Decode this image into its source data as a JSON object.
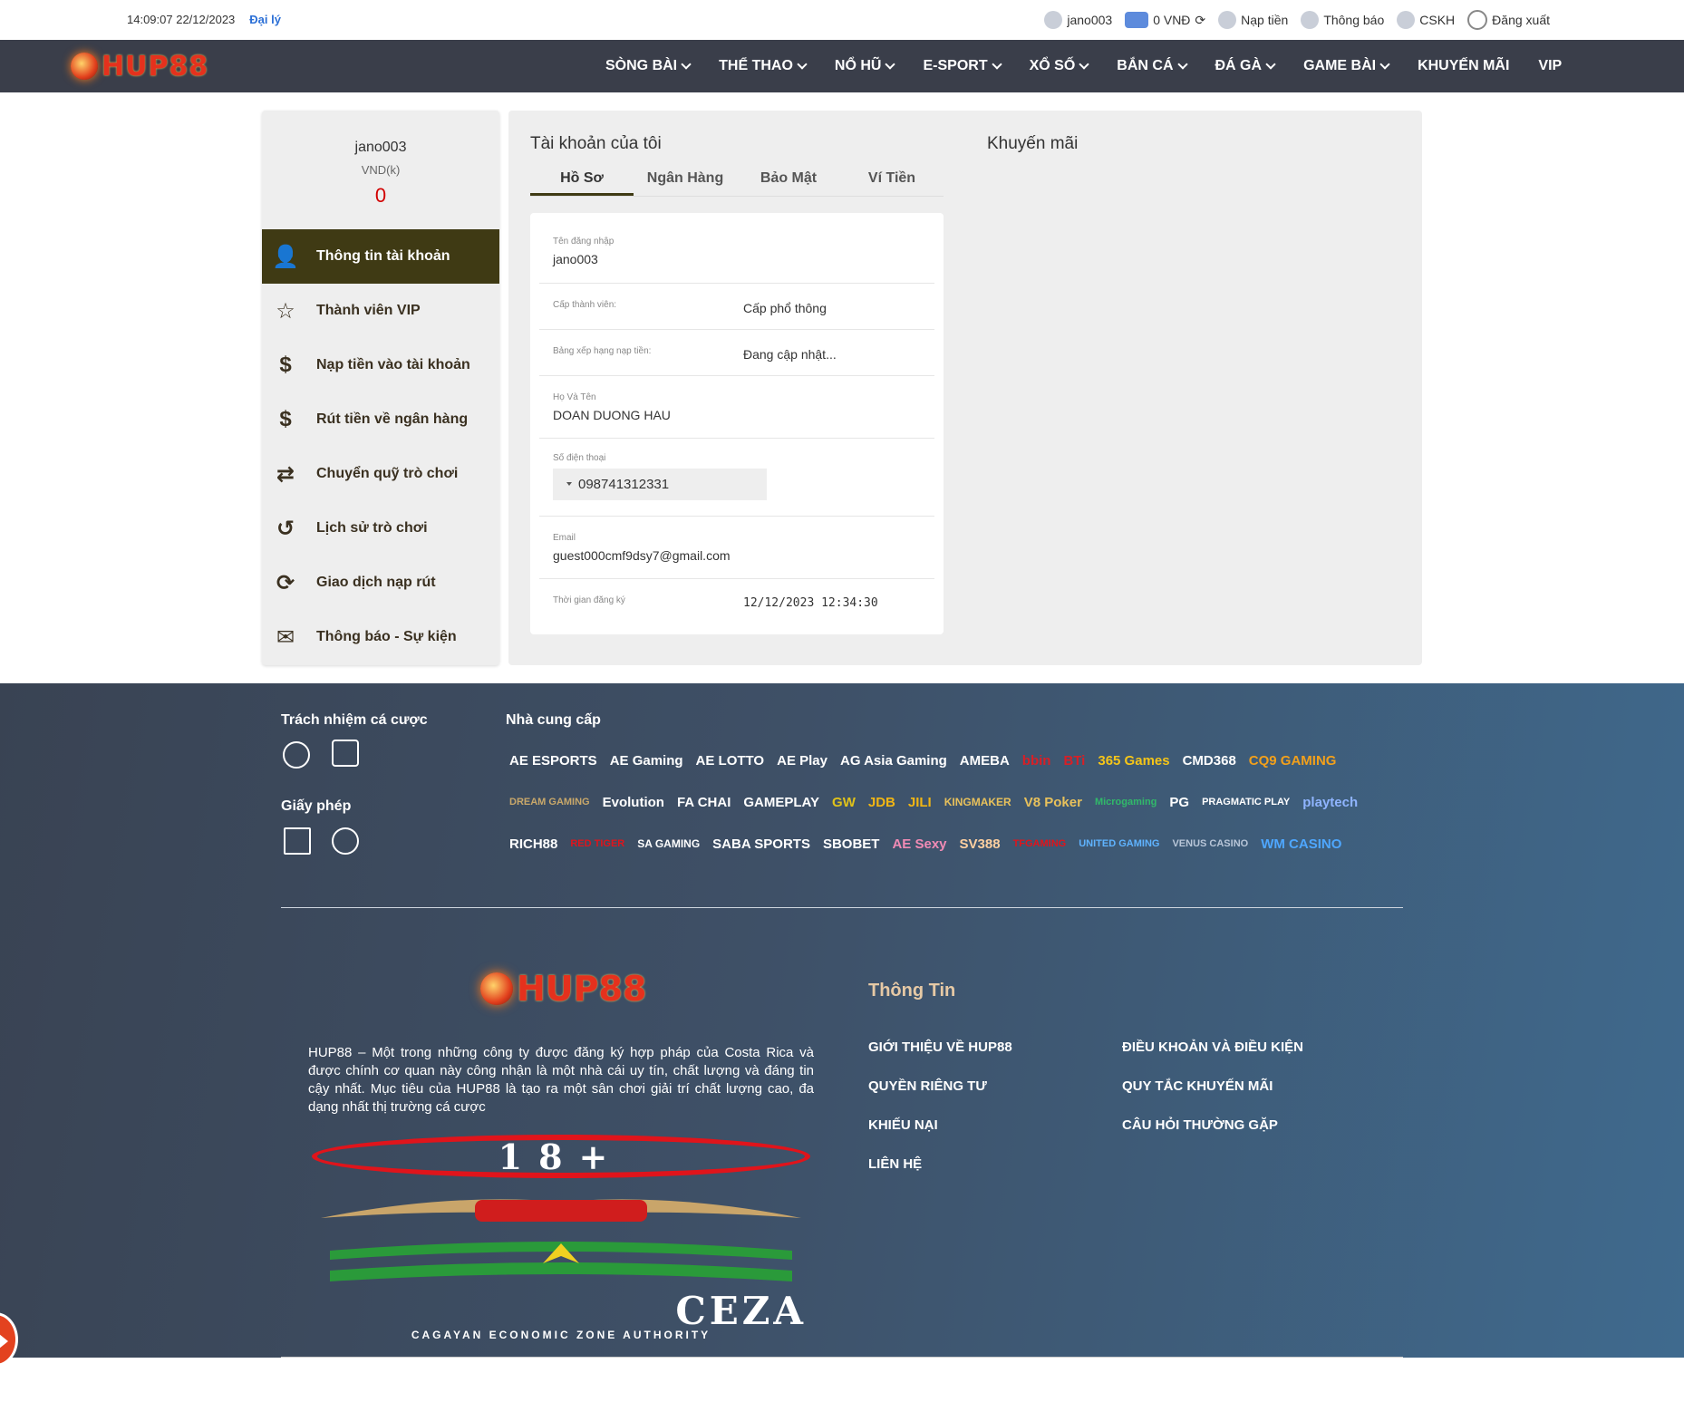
{
  "topbar": {
    "datetime": "14:09:07 22/12/2023",
    "agent": "Đại lý",
    "username": "jano003",
    "balance": "0 VNĐ",
    "deposit": "Nạp tiền",
    "notifications": "Thông báo",
    "support": "CSKH",
    "logout": "Đăng xuất"
  },
  "brand": {
    "logo_text": "HUP88"
  },
  "nav": [
    "SÒNG BÀI",
    "THỂ THAO",
    "NỔ HŨ",
    "E-SPORT",
    "XỔ SỐ",
    "BẮN CÁ",
    "ĐÁ GÀ",
    "GAME BÀI",
    "KHUYẾN MÃI",
    "VIP"
  ],
  "sidebar": {
    "username": "jano003",
    "currency": "VND(k)",
    "balance": "0",
    "items": [
      {
        "label": "Thông tin tài khoản",
        "icon": "user-icon"
      },
      {
        "label": "Thành viên VIP",
        "icon": "star-icon"
      },
      {
        "label": "Nạp tiền vào tài khoản",
        "icon": "deposit-hand-icon"
      },
      {
        "label": "Rút tiền về ngân hàng",
        "icon": "dollar-icon"
      },
      {
        "label": "Chuyển quỹ trò chơi",
        "icon": "transfer-icon"
      },
      {
        "label": "Lịch sử trò chơi",
        "icon": "history-icon"
      },
      {
        "label": "Giao dịch nạp rút",
        "icon": "refresh-icon"
      },
      {
        "label": "Thông báo - Sự kiện",
        "icon": "mail-icon"
      }
    ]
  },
  "account": {
    "title": "Tài khoản của tôi",
    "promo_title": "Khuyến mãi",
    "tabs": [
      "Hồ Sơ",
      "Ngân Hàng",
      "Bảo Mật",
      "Ví Tiền"
    ],
    "fields": {
      "login_label": "Tên đăng nhập",
      "login_value": "jano003",
      "level_label": "Cấp thành viên:",
      "level_value": "Cấp phổ thông",
      "rank_label": "Bảng xếp hạng nạp tiền:",
      "rank_value": "Đang cập nhật...",
      "name_label": "Họ Và Tên",
      "name_value": "DOAN DUONG HAU",
      "phone_label": "Số điện thoại",
      "phone_value": "098741312331",
      "email_label": "Email",
      "email_value": "guest000cmf9dsy7@gmail.com",
      "reg_label": "Thời gian đăng ký",
      "reg_value": "12/12/2023 12:34:30"
    }
  },
  "footer": {
    "responsibility": "Trách nhiệm cá cược",
    "license": "Giấy phép",
    "providers_title": "Nhà cung cấp",
    "providers": [
      "AE ESPORTS",
      "AE Gaming",
      "AE LOTTO",
      "AE Play",
      "AG Asia Gaming",
      "AMEBA",
      "bbin",
      "BTi",
      "365 Games",
      "CMD368",
      "CQ9 GAMING",
      "DREAM GAMING",
      "Evolution",
      "FA CHAI",
      "GAMEPLAY",
      "GW",
      "JDB",
      "JILI",
      "KINGMAKER",
      "V8 Poker",
      "Microgaming",
      "PG",
      "PRAGMATIC PLAY",
      "playtech",
      "RICH88",
      "RED TIGER",
      "SA GAMING",
      "SABA SPORTS",
      "SBOBET",
      "AE Sexy",
      "SV388",
      "TFGAMING",
      "UNITED GAMING",
      "VENUS CASINO",
      "WM CASINO"
    ],
    "description": "HUP88 – Một trong những công ty được đăng ký hợp pháp của Costa Rica và được chính cơ quan này công nhận là một nhà cái uy tín, chất lượng và đáng tin cậy nhất. Mục tiêu của HUP88 là tạo ra một sân chơi giải trí chất lượng cao, đa dạng nhất thị trường cá cược",
    "badge18": "18+",
    "ceza": "CEZA",
    "ceza_sub": "CAGAYAN ECONOMIC ZONE AUTHORITY",
    "info_title": "Thông Tin",
    "links_col1": [
      "GIỚI THIỆU VỀ HUP88",
      "QUYỀN RIÊNG TƯ",
      "KHIẾU NẠI",
      "LIÊN HỆ"
    ],
    "links_col2": [
      "ĐIỀU KHOẢN VÀ ĐIỀU KIỆN",
      "QUY TẮC KHUYẾN MÃI",
      "CÂU HỎI THƯỜNG GẶP"
    ]
  },
  "colors": {
    "nav_bg": "#3a3e4a",
    "active_side": "#3f3a14",
    "balance_red": "#d20000",
    "link_blue": "#2b6fd6"
  }
}
